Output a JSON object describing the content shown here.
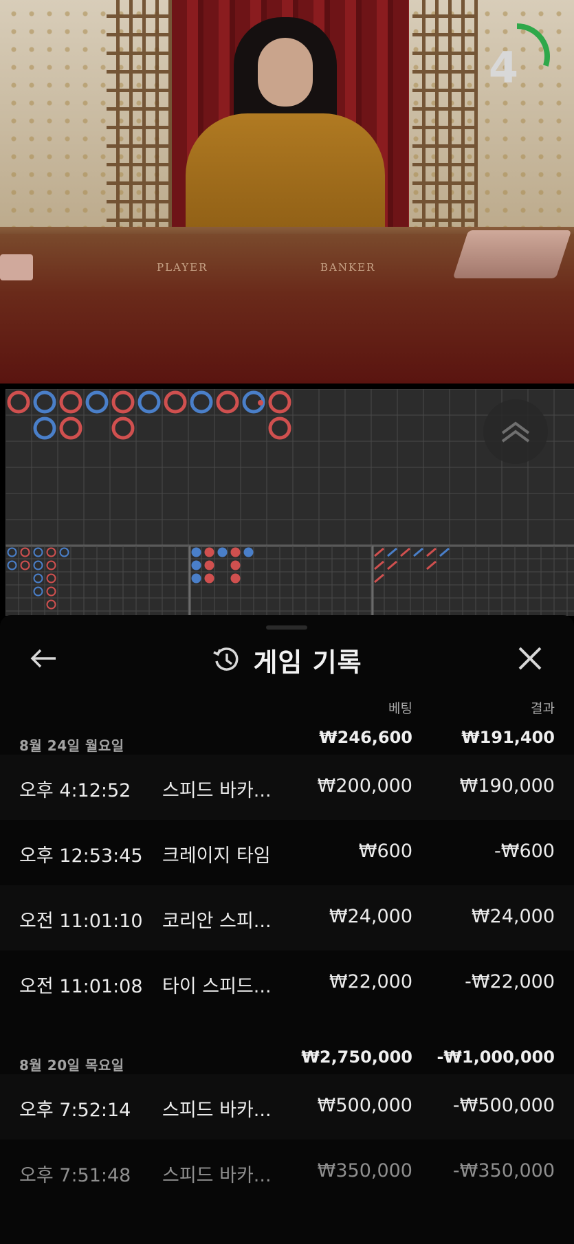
{
  "video": {
    "countdown": "4",
    "countdown_fraction": 0.3,
    "table_labels": {
      "player": "PLAYER",
      "banker": "BANKER"
    },
    "colors": {
      "player": "#4a7fc9",
      "banker": "#d0504f",
      "timer": "#2fa84a"
    }
  },
  "roadmap": {
    "big_road": [
      [
        "B"
      ],
      [
        "P",
        "P"
      ],
      [
        "B",
        "B"
      ],
      [
        "P"
      ],
      [
        "B",
        "B"
      ],
      [
        "P"
      ],
      [
        "B"
      ],
      [
        "P"
      ],
      [
        "B"
      ],
      [
        "P*"
      ],
      [
        "B",
        "B"
      ]
    ],
    "big_eye_boy": [
      [
        "P",
        "P"
      ],
      [
        "B",
        "B"
      ],
      [
        "P",
        "P",
        "P",
        "P"
      ],
      [
        "B",
        "B",
        "B",
        "B",
        "B"
      ],
      [
        "P"
      ]
    ],
    "small_road": [
      [
        "P",
        "P",
        "P"
      ],
      [
        "B",
        "B",
        "B"
      ],
      [
        "P"
      ],
      [
        "B",
        "B",
        "B"
      ],
      [
        "P"
      ]
    ],
    "cockroach_pig": [
      [
        "B",
        "B",
        "B"
      ],
      [
        "P",
        "B"
      ],
      [
        "B"
      ],
      [
        "P"
      ],
      [
        "B",
        "B"
      ],
      [
        "P"
      ]
    ]
  },
  "history": {
    "title": "게임 기록",
    "back_icon": "arrow-left-icon",
    "close_icon": "close-icon",
    "columns": {
      "bet": "베팅",
      "result": "결과"
    },
    "days": [
      {
        "date": "8월 24일 월요일",
        "bet_total": "₩246,600",
        "result_total": "₩191,400",
        "records": [
          {
            "time": "오후 4:12:52",
            "game": "스피드 바카...",
            "bet": "₩200,000",
            "result": "₩190,000"
          },
          {
            "time": "오후 12:53:45",
            "game": "크레이지 타임",
            "bet": "₩600",
            "result": "-₩600"
          },
          {
            "time": "오전 11:01:10",
            "game": "코리안 스피...",
            "bet": "₩24,000",
            "result": "₩24,000"
          },
          {
            "time": "오전 11:01:08",
            "game": "타이 스피드...",
            "bet": "₩22,000",
            "result": "-₩22,000"
          }
        ]
      },
      {
        "date": "8월 20일 목요일",
        "bet_total": "₩2,750,000",
        "result_total": "-₩1,000,000",
        "records": [
          {
            "time": "오후 7:52:14",
            "game": "스피드 바카...",
            "bet": "₩500,000",
            "result": "-₩500,000"
          },
          {
            "time": "오후 7:51:48",
            "game": "스피드 바카...",
            "bet": "₩350,000",
            "result": "-₩350,000"
          }
        ]
      }
    ]
  }
}
